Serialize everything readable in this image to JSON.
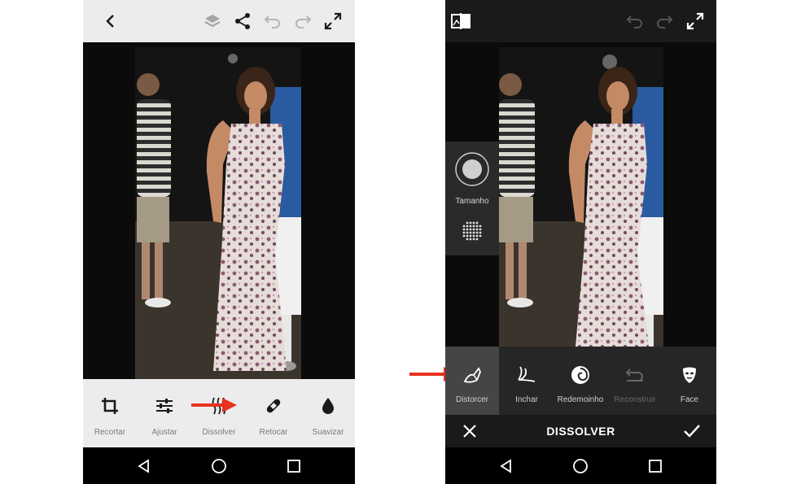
{
  "left_screen": {
    "toolbar": [
      {
        "label": "Recortar",
        "icon": "crop-icon"
      },
      {
        "label": "Ajustar",
        "icon": "sliders-icon"
      },
      {
        "label": "Dissolver",
        "icon": "liquify-icon"
      },
      {
        "label": "Retocar",
        "icon": "bandage-icon"
      },
      {
        "label": "Suavizar",
        "icon": "drop-icon"
      }
    ]
  },
  "right_screen": {
    "brush_size_label": "Tamanho",
    "tools": [
      {
        "label": "Distorcer",
        "icon": "distort-icon",
        "active": true
      },
      {
        "label": "Inchar",
        "icon": "bloat-icon",
        "active": false
      },
      {
        "label": "Redemoinho",
        "icon": "swirl-icon",
        "active": false
      },
      {
        "label": "Reconstruir",
        "icon": "reconstruct-icon",
        "active": false,
        "disabled": true
      },
      {
        "label": "Face",
        "icon": "face-icon",
        "active": false
      }
    ],
    "title": "DISSOLVER"
  },
  "colors": {
    "annotation_arrow": "#e8321e",
    "light_bar": "#ececec",
    "dark_bar": "#1a1a1a",
    "active_tool": "#454545"
  }
}
